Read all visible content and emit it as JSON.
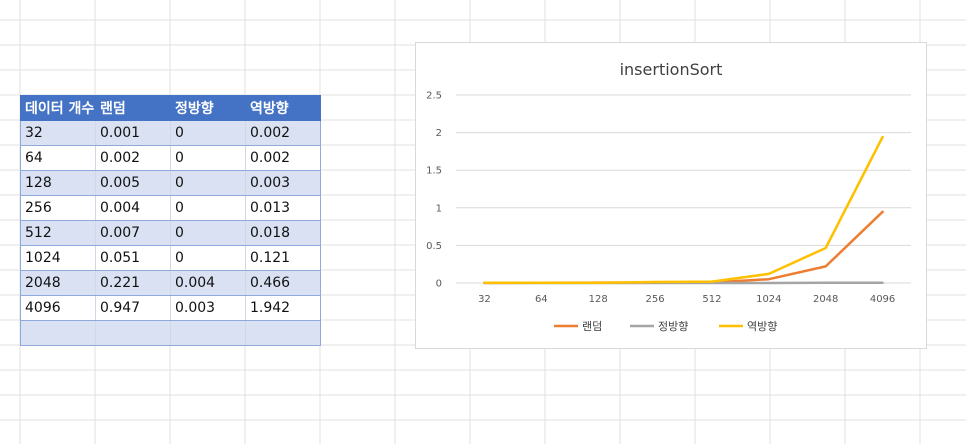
{
  "table": {
    "headers": [
      "데이터 개수",
      "랜덤",
      "정방향",
      "역방향"
    ],
    "rows": [
      [
        "32",
        "0.001",
        "0",
        "0.002"
      ],
      [
        "64",
        "0.002",
        "0",
        "0.002"
      ],
      [
        "128",
        "0.005",
        "0",
        "0.003"
      ],
      [
        "256",
        "0.004",
        "0",
        "0.013"
      ],
      [
        "512",
        "0.007",
        "0",
        "0.018"
      ],
      [
        "1024",
        "0.051",
        "0",
        "0.121"
      ],
      [
        "2048",
        "0.221",
        "0.004",
        "0.466"
      ],
      [
        "4096",
        "0.947",
        "0.003",
        "1.942"
      ],
      [
        "",
        "",
        "",
        ""
      ]
    ]
  },
  "chart_data": {
    "type": "line",
    "title": "insertionSort",
    "categories": [
      "32",
      "64",
      "128",
      "256",
      "512",
      "1024",
      "2048",
      "4096"
    ],
    "ylim": [
      0,
      2.5
    ],
    "yticks": [
      0,
      0.5,
      1,
      1.5,
      2,
      2.5
    ],
    "grid": true,
    "legend_position": "bottom",
    "series": [
      {
        "name": "랜덤",
        "color": "#ed7d31",
        "values": [
          0.001,
          0.002,
          0.005,
          0.004,
          0.007,
          0.051,
          0.221,
          0.947
        ]
      },
      {
        "name": "정방향",
        "color": "#a5a5a5",
        "values": [
          0,
          0,
          0,
          0,
          0,
          0,
          0.004,
          0.003
        ]
      },
      {
        "name": "역방향",
        "color": "#ffc000",
        "values": [
          0.002,
          0.002,
          0.003,
          0.013,
          0.018,
          0.121,
          0.466,
          1.942
        ]
      }
    ]
  }
}
